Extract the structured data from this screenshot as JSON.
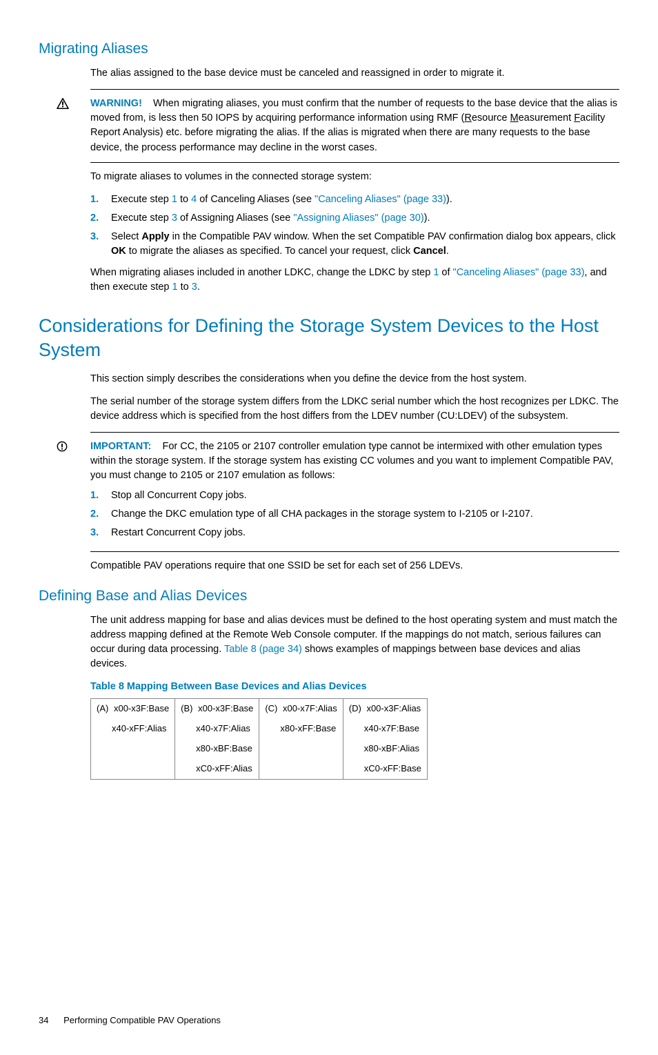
{
  "h_migrating": "Migrating Aliases",
  "p_migrating_intro": "The alias assigned to the base device must be canceled and reassigned in order to migrate it.",
  "warning_label": "WARNING!",
  "warning_pre": "When migrating aliases, you must confirm that the number of requests to the base device that the alias is moved from, is less then 50 IOPS by acquiring performance information using RMF (",
  "warning_r": "R",
  "warning_r2": "esource ",
  "warning_m": "M",
  "warning_m2": "easurement ",
  "warning_f": "F",
  "warning_post": "acility Report Analysis) etc. before migrating the alias. If the alias is migrated when there are many requests to the base device, the process performance may decline in the worst cases.",
  "migrate_steps_intro": "To migrate aliases to volumes in the connected storage system:",
  "n1": "1.",
  "n2": "2.",
  "n3": "3.",
  "step1_a": "Execute step ",
  "step1_num1": "1",
  "step1_b": " to ",
  "step1_num2": "4",
  "step1_c": " of Canceling Aliases (see ",
  "step1_link": "\"Canceling Aliases\" (page 33)",
  "step1_d": ").",
  "step2_a": "Execute step ",
  "step2_num1": "3",
  "step2_b": " of Assigning Aliases (see ",
  "step2_link": "\"Assigning Aliases\" (page 30)",
  "step2_c": ").",
  "step3_a": "Select ",
  "step3_apply": "Apply",
  "step3_b": " in the Compatible PAV window. When the set Compatible PAV confirmation dialog box appears, click ",
  "step3_ok": "OK",
  "step3_c": " to migrate the aliases as specified. To cancel your request, click ",
  "step3_cancel": "Cancel",
  "step3_d": ".",
  "migrate_tail_a": "When migrating aliases included in another LDKC, change the LDKC by step ",
  "migrate_tail_num1": "1",
  "migrate_tail_b": " of ",
  "migrate_tail_link": "\"Canceling Aliases\" (page 33)",
  "migrate_tail_c": ", and then execute step ",
  "migrate_tail_num2": "1",
  "migrate_tail_d": " to ",
  "migrate_tail_num3": "3",
  "migrate_tail_e": ".",
  "h_considerations": "Considerations for Defining the Storage System Devices to the Host System",
  "cons_p1": "This section simply describes the considerations when you define the device from the host system.",
  "cons_p2": "The serial number of the storage system differs from the LDKC serial number which the host recognizes per LDKC. The device address which is specified from the host differs from the LDEV number (CU:LDEV) of the subsystem.",
  "important_label": "IMPORTANT:",
  "important_body": "For CC, the 2105 or 2107 controller emulation type cannot be intermixed with other emulation types within the storage system. If the storage system has existing CC volumes and you want to implement Compatible PAV, you must change to 2105 or 2107 emulation as follows:",
  "imp_s1": "Stop all Concurrent Copy jobs.",
  "imp_s2": "Change the DKC emulation type of all CHA packages in the storage system to I-2105 or I-2107.",
  "imp_s3": "Restart Concurrent Copy jobs.",
  "ssid_para": "Compatible PAV operations require that one SSID be set for each set of 256 LDEVs.",
  "h_defining": "Defining Base and Alias Devices",
  "def_p_a": "The unit address mapping for base and alias devices must be defined to the host operating system and must match the address mapping defined at the Remote Web Console computer. If the mappings do not match, serious failures can occur during data processing. ",
  "def_p_link": "Table 8 (page 34)",
  "def_p_b": " shows examples of mappings between base devices and alias devices.",
  "table_title": "Table 8 Mapping Between Base Devices and Alias Devices",
  "t": {
    "A": "(A)",
    "B": "(B)",
    "C": "(C)",
    "D": "(D)",
    "r1c1": "x00-x3F:Base",
    "r1c2": "x00-x3F:Base",
    "r1c3": "x00-x7F:Alias",
    "r1c4": "x00-x3F:Alias",
    "r2c1": "x40-xFF:Alias",
    "r2c2": "x40-x7F:Alias",
    "r2c3": "x80-xFF:Base",
    "r2c4": "x40-x7F:Base",
    "r3c2": "x80-xBF:Base",
    "r3c4": "x80-xBF:Alias",
    "r4c2": "xC0-xFF:Alias",
    "r4c4": "xC0-xFF:Base"
  },
  "footer_page": "34",
  "footer_text": "Performing Compatible PAV Operations"
}
